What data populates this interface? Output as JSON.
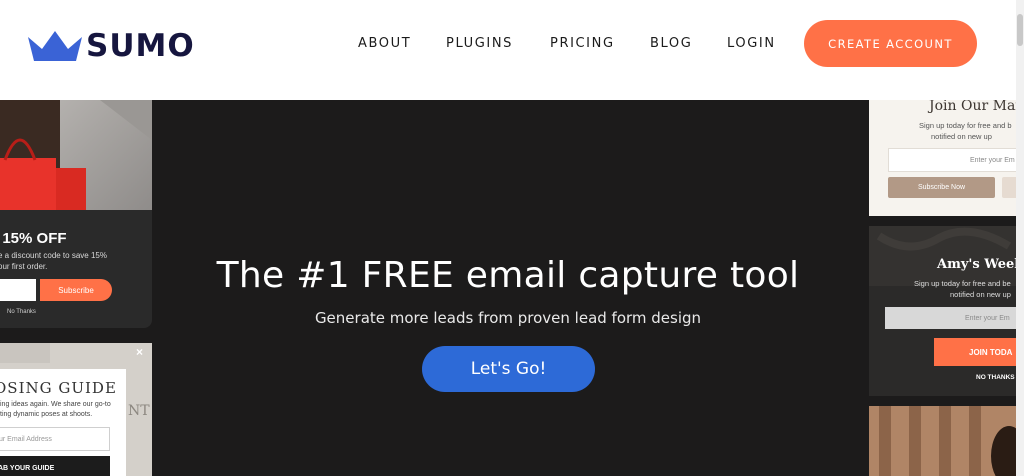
{
  "header": {
    "logo_text": "SUMO",
    "nav": [
      "ABOUT",
      "PLUGINS",
      "PRICING",
      "BLOG",
      "LOGIN"
    ],
    "cta_label": "CREATE ACCOUNT"
  },
  "hero": {
    "headline": "The #1 FREE email capture tool",
    "subheadline": "Generate more leads from proven lead form design",
    "button_label": "Let's Go!"
  },
  "left_cards": {
    "discount": {
      "title": "/ 15% OFF",
      "text_line1": "e a discount code to save 15%",
      "text_line2": "our first order.",
      "button_label": "Subscribe",
      "no_thanks": "No Thanks"
    },
    "guide": {
      "close": "×",
      "title": "OSING GUIDE",
      "text_line1": "ing ideas again. We share our go-to",
      "text_line2": "ting dynamic poses at shoots.",
      "input_placeholder": "ur Email Address",
      "button_label": "AB YOUR GUIDE"
    }
  },
  "right_cards": {
    "mailing": {
      "title": "Join Our Mail",
      "text_line1": "Sign up today for free and b",
      "text_line2": "notified on new up",
      "input_placeholder": "Enter your Em",
      "button_label": "Subscribe Now"
    },
    "weekly": {
      "title": "Amy's Weekl",
      "text_line1": "Sign up today for free and be",
      "text_line2": "notified on new up",
      "input_placeholder": "Enter your Em",
      "button_label": "JOIN TODA",
      "no_thanks": "NO THANKS"
    }
  },
  "colors": {
    "brand_navy": "#16163f",
    "brand_blue": "#3a63d6",
    "cta_orange": "#ff7147",
    "hero_bg": "#1c1b1b",
    "go_button": "#2d6ad7"
  }
}
